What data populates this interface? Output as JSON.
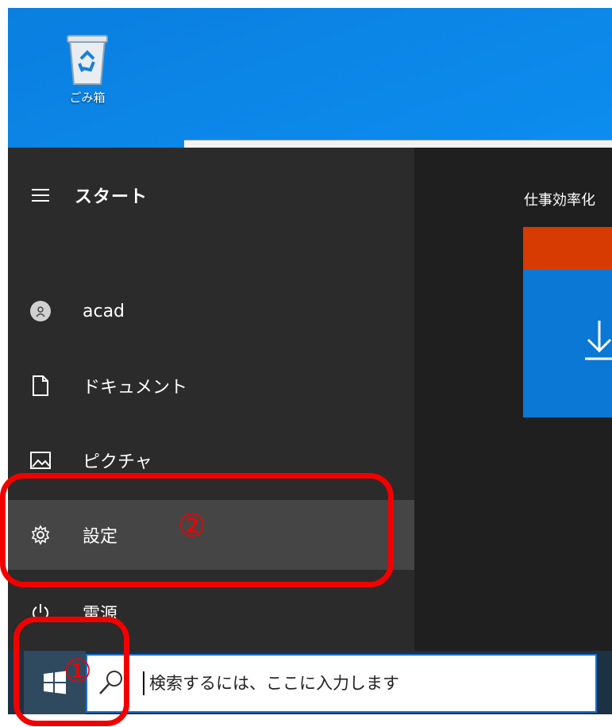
{
  "desktop": {
    "recycle_bin_label": "ごみ箱"
  },
  "start_menu": {
    "title": "スタート",
    "items": [
      {
        "label": "acad",
        "icon": "user-avatar-icon"
      },
      {
        "label": "ドキュメント",
        "icon": "document-icon"
      },
      {
        "label": "ピクチャ",
        "icon": "picture-icon"
      },
      {
        "label": "設定",
        "icon": "gear-icon"
      },
      {
        "label": "電源",
        "icon": "power-icon"
      }
    ],
    "tile_group_label": "仕事効率化"
  },
  "taskbar": {
    "search_placeholder": "検索するには、ここに入力します"
  },
  "annotations": {
    "step1": "①",
    "step2": "②"
  },
  "colors": {
    "annotation": "#f20000",
    "start_bg": "#2b2b2b",
    "highlight": "#454545",
    "tile_blue": "#0a78d4",
    "tile_orange": "#d83b01",
    "desktop_blue": "#0d8ff0"
  }
}
